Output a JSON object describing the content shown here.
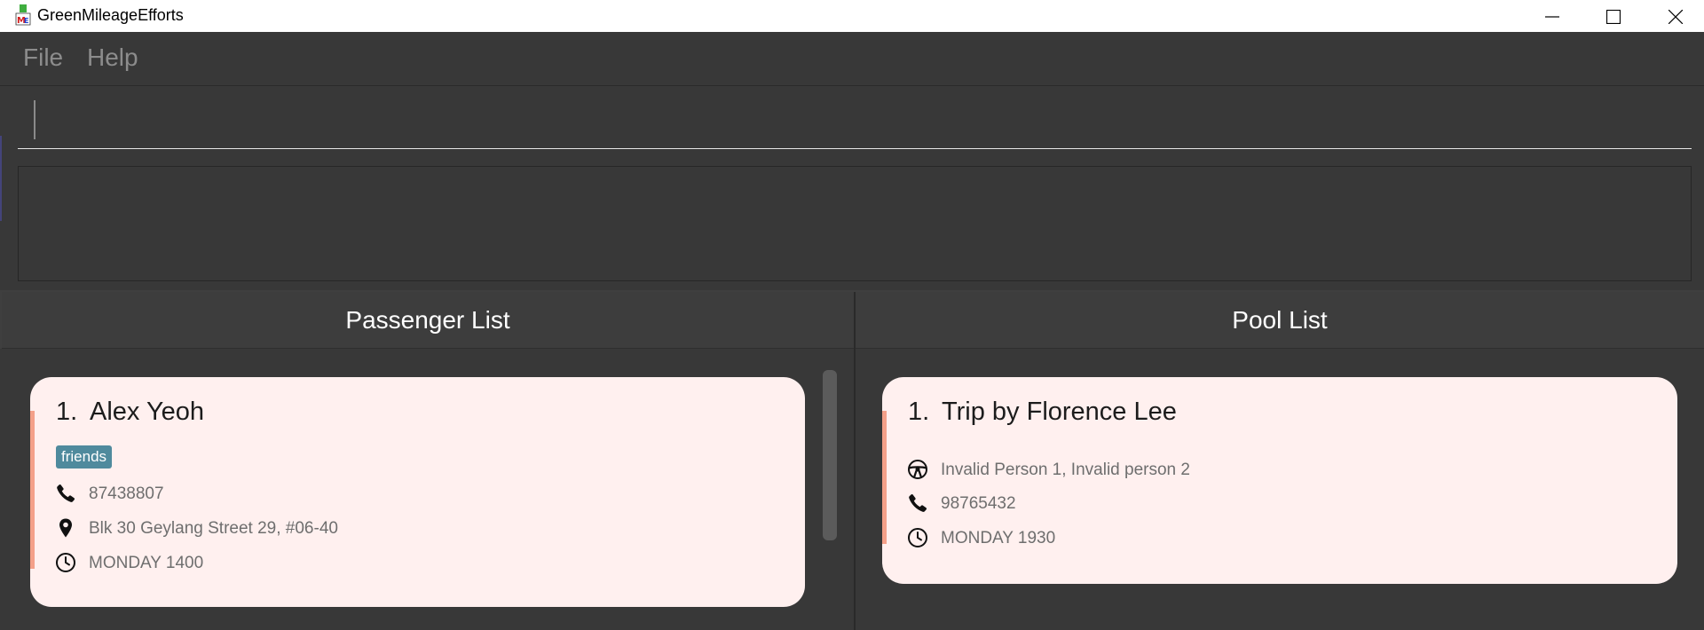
{
  "window": {
    "title": "GreenMileageEfforts",
    "icon": "app-logo-icon",
    "controls": [
      "minimize-icon",
      "maximize-icon",
      "close-icon"
    ]
  },
  "menu": {
    "file": "File",
    "help": "Help"
  },
  "command": {
    "value": "",
    "placeholder": ""
  },
  "result": {
    "text": ""
  },
  "passenger_panel": {
    "title": "Passenger List",
    "items": [
      {
        "index": "1.",
        "name": "Alex Yeoh",
        "tags": [
          "friends"
        ],
        "phone": "87438807",
        "address": "Blk 30 Geylang Street 29, #06-40",
        "time": "MONDAY 1400"
      }
    ]
  },
  "pool_panel": {
    "title": "Pool List",
    "items": [
      {
        "index": "1.",
        "name": "Trip by Florence Lee",
        "passengers": "Invalid Person 1, Invalid person 2",
        "phone": "98765432",
        "time": "MONDAY 1930"
      }
    ]
  },
  "colors": {
    "background": "#383838",
    "card": "#fff0ef",
    "card_accent": "#f4a089",
    "tag": "#4f8a9d"
  }
}
